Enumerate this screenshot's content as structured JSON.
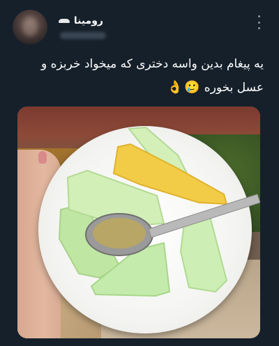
{
  "author": {
    "display_name": "رومینا",
    "avatar_icon": "avatar"
  },
  "tweet": {
    "text_line1": "یه پیغام بدین واسه دختری که میخواد خربزه و",
    "text_line2": "عسل بخوره",
    "emojis": [
      "🥲",
      "👌"
    ]
  },
  "colors": {
    "background": "#15202b",
    "text": "#ffffff",
    "muted": "#8b98a5"
  }
}
